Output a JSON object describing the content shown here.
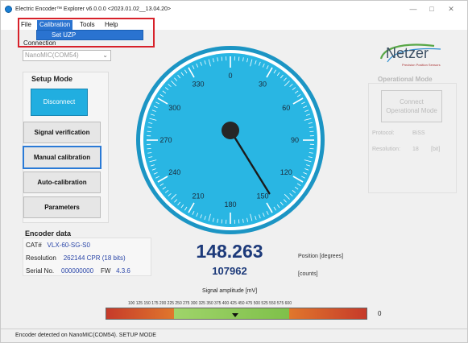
{
  "window": {
    "title": "Electric Encoder™ Explorer v6.0.0.0  <2023.01.02__13.04.20>",
    "minimize": "—",
    "maximize": "□",
    "close": "✕"
  },
  "menubar": {
    "items": [
      "File",
      "Calibration",
      "Tools",
      "Help"
    ],
    "active": "Calibration",
    "dropdown_item": "Set UZP"
  },
  "connection": {
    "label": "Connection",
    "port": "NanoMIC(COM54)"
  },
  "setup_mode": {
    "title": "Setup Mode",
    "connect_button": "Disconnect",
    "buttons": [
      "Signal verification",
      "Manual calibration",
      "Auto-calibration",
      "Parameters"
    ],
    "selected": "Manual calibration"
  },
  "encoder_data": {
    "title": "Encoder data",
    "cat_label": "CAT#",
    "cat_value": "VLX-60-SG-S0",
    "resolution_label": "Resolution",
    "resolution_value": "262144 CPR (18 bits)",
    "serial_label": "Serial No.",
    "serial_value": "000000000",
    "fw_label": "FW",
    "fw_value": "4.3.6"
  },
  "gauge": {
    "tick_labels": [
      "0",
      "30",
      "60",
      "90",
      "120",
      "150",
      "180",
      "210",
      "240",
      "270",
      "300",
      "330"
    ],
    "needle_degrees": 148.263,
    "face_color": "#29b6e3",
    "ring_color": "#1ea4d4"
  },
  "readout": {
    "position_value": "148.263",
    "position_unit": "Position [degrees]",
    "count_value": "107962",
    "count_unit": "[counts]"
  },
  "signal": {
    "title": "Signal amplitude [mV]",
    "scale": "100 125 150 175 200  225 250 275 300 325  350 375 400 425 450 475 500  525 550 575 600",
    "value": "0",
    "marker_mv": 375
  },
  "logo": {
    "name": "Netzer",
    "tagline": "Precision Position Sensors"
  },
  "operational_mode": {
    "title": "Operational Mode",
    "button_line1": "Connect",
    "button_line2": "Operational Mode",
    "protocol_label": "Protocol:",
    "protocol_value": "BiSS",
    "resolution_label": "Resolution:",
    "resolution_value": "18",
    "resolution_unit": "[bit]"
  },
  "status": {
    "text": "Encoder detected on NanoMIC(COM54). SETUP MODE"
  }
}
